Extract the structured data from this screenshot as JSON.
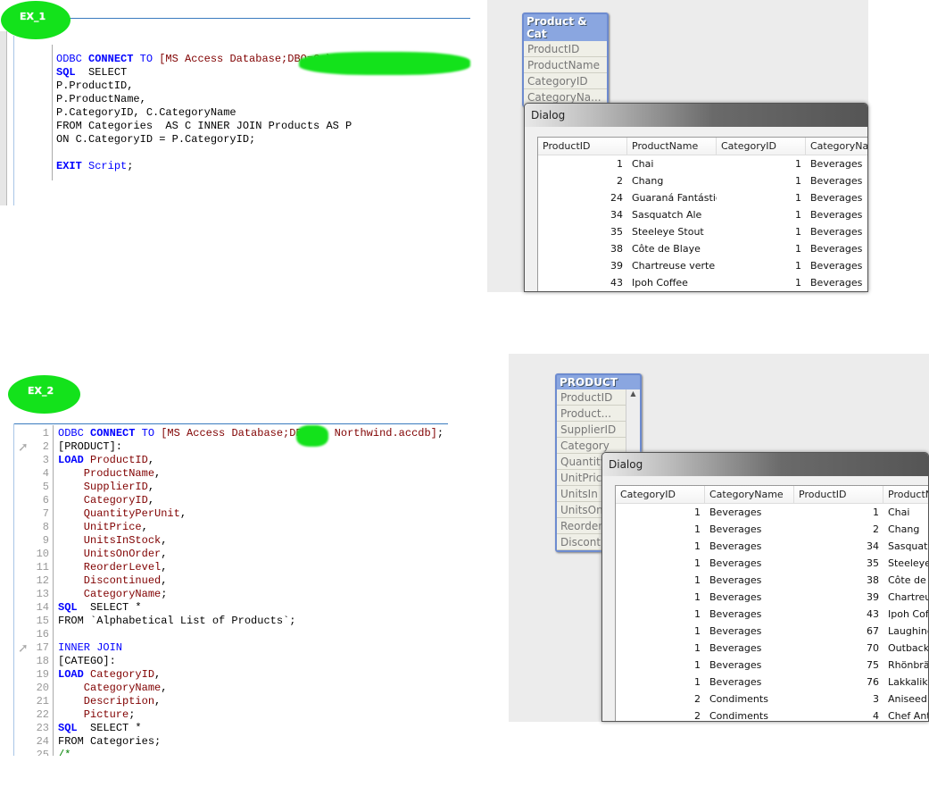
{
  "ex1": {
    "label": "EX_1",
    "code": [
      [
        [
          "kl",
          "ODBC "
        ],
        [
          "kw",
          "CONNECT "
        ],
        [
          "kl",
          "TO "
        ],
        [
          "rd",
          "[MS Access Database;DBQ=C:\\Us"
        ]
      ],
      [
        [
          "kw",
          "SQL"
        ],
        [
          "",
          "  SELECT"
        ]
      ],
      [
        [
          "",
          "P.ProductID,"
        ]
      ],
      [
        [
          "",
          "P.ProductName,"
        ]
      ],
      [
        [
          "",
          "P.CategoryID, C.CategoryName"
        ]
      ],
      [
        [
          "",
          "FROM Categories  AS C INNER JOIN Products AS P"
        ]
      ],
      [
        [
          "",
          "ON C.CategoryID = P.CategoryID;"
        ]
      ],
      [
        [
          "",
          ""
        ]
      ],
      [
        [
          "kw",
          "EXIT "
        ],
        [
          "kl",
          "Script"
        ],
        [
          "",
          ";"
        ]
      ]
    ],
    "table_box": {
      "title": "Product & Cat",
      "fields": [
        "ProductID",
        "ProductName",
        "CategoryID",
        "CategoryNa..."
      ]
    },
    "dialog": {
      "title": "Dialog",
      "columns": [
        "ProductID",
        "ProductName",
        "CategoryID",
        "CategoryNam"
      ],
      "rows": [
        [
          1,
          "Chai",
          1,
          "Beverages"
        ],
        [
          2,
          "Chang",
          1,
          "Beverages"
        ],
        [
          24,
          "Guaraná Fantástica",
          1,
          "Beverages"
        ],
        [
          34,
          "Sasquatch Ale",
          1,
          "Beverages"
        ],
        [
          35,
          "Steeleye Stout",
          1,
          "Beverages"
        ],
        [
          38,
          "Côte de Blaye",
          1,
          "Beverages"
        ],
        [
          39,
          "Chartreuse verte",
          1,
          "Beverages"
        ],
        [
          43,
          "Ipoh Coffee",
          1,
          "Beverages"
        ]
      ]
    }
  },
  "ex2": {
    "label": "EX_2",
    "code": [
      [
        [
          "kl",
          "ODBC "
        ],
        [
          "kw",
          "CONNECT "
        ],
        [
          "kl",
          "TO "
        ],
        [
          "rd",
          "[MS Access Database;DB     Northwind.accdb]"
        ],
        [
          "",
          ";"
        ]
      ],
      [
        [
          "",
          "[PRODUCT]:"
        ]
      ],
      [
        [
          "kw",
          "LOAD "
        ],
        [
          "rd",
          "ProductID"
        ],
        [
          "",
          ","
        ]
      ],
      [
        [
          "rd",
          "    ProductName"
        ],
        [
          "",
          ","
        ]
      ],
      [
        [
          "rd",
          "    SupplierID"
        ],
        [
          "",
          ","
        ]
      ],
      [
        [
          "rd",
          "    CategoryID"
        ],
        [
          "",
          ","
        ]
      ],
      [
        [
          "rd",
          "    QuantityPerUnit"
        ],
        [
          "",
          ","
        ]
      ],
      [
        [
          "rd",
          "    UnitPrice"
        ],
        [
          "",
          ","
        ]
      ],
      [
        [
          "rd",
          "    UnitsInStock"
        ],
        [
          "",
          ","
        ]
      ],
      [
        [
          "rd",
          "    UnitsOnOrder"
        ],
        [
          "",
          ","
        ]
      ],
      [
        [
          "rd",
          "    ReorderLevel"
        ],
        [
          "",
          ","
        ]
      ],
      [
        [
          "rd",
          "    Discontinued"
        ],
        [
          "",
          ","
        ]
      ],
      [
        [
          "rd",
          "    CategoryName"
        ],
        [
          "",
          ";"
        ]
      ],
      [
        [
          "kw",
          "SQL"
        ],
        [
          "",
          "  SELECT *"
        ]
      ],
      [
        [
          "",
          "FROM `Alphabetical List of Products`;"
        ]
      ],
      [
        [
          "",
          ""
        ]
      ],
      [
        [
          "kl",
          "INNER JOIN"
        ]
      ],
      [
        [
          "",
          "[CATEGO]:"
        ]
      ],
      [
        [
          "kw",
          "LOAD "
        ],
        [
          "rd",
          "CategoryID"
        ],
        [
          "",
          ","
        ]
      ],
      [
        [
          "rd",
          "    CategoryName"
        ],
        [
          "",
          ","
        ]
      ],
      [
        [
          "rd",
          "    Description"
        ],
        [
          "",
          ","
        ]
      ],
      [
        [
          "rd",
          "    Picture"
        ],
        [
          "",
          ";"
        ]
      ],
      [
        [
          "kw",
          "SQL"
        ],
        [
          "",
          "  SELECT *"
        ]
      ],
      [
        [
          "",
          "FROM Categories;"
        ]
      ],
      [
        [
          "gr",
          "/*"
        ]
      ]
    ],
    "table_box": {
      "title": "PRODUCT",
      "fields": [
        "ProductID",
        "Product...",
        "SupplierID",
        "Category",
        "Quantity",
        "UnitPric",
        "UnitsIn",
        "UnitsOn",
        "Reorder",
        "Disconti"
      ]
    },
    "dialog": {
      "title": "Dialog",
      "columns": [
        "CategoryID",
        "CategoryName",
        "ProductID",
        "ProductNa"
      ],
      "rows": [
        [
          1,
          "Beverages",
          1,
          "Chai"
        ],
        [
          1,
          "Beverages",
          2,
          "Chang"
        ],
        [
          1,
          "Beverages",
          34,
          "Sasquatch"
        ],
        [
          1,
          "Beverages",
          35,
          "Steeleye S"
        ],
        [
          1,
          "Beverages",
          38,
          "Côte de B"
        ],
        [
          1,
          "Beverages",
          39,
          "Chartreus"
        ],
        [
          1,
          "Beverages",
          43,
          "Ipoh Coffe"
        ],
        [
          1,
          "Beverages",
          67,
          "Laughing L"
        ],
        [
          1,
          "Beverages",
          70,
          "Outback L"
        ],
        [
          1,
          "Beverages",
          75,
          "Rhönbräu"
        ],
        [
          1,
          "Beverages",
          76,
          "Lakkalikö"
        ],
        [
          2,
          "Condiments",
          3,
          "Aniseed S"
        ],
        [
          2,
          "Condiments",
          4,
          "Chef Anto"
        ]
      ]
    }
  }
}
